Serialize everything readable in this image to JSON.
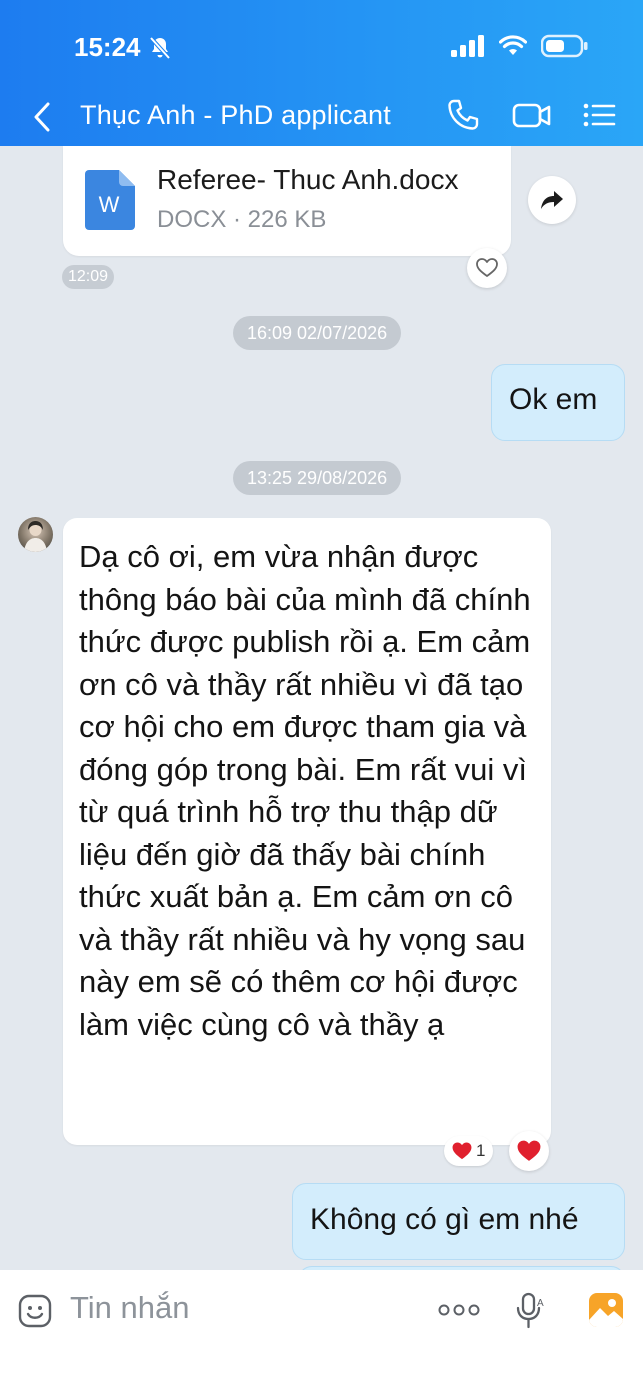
{
  "status_bar": {
    "time": "15:24"
  },
  "header": {
    "title": "Thục Anh - PhD applicant"
  },
  "messages": {
    "file": {
      "name": "Referee- Thuc Anh.docx",
      "meta": "DOCX · 226 KB",
      "icon_letter": "W",
      "time": "12:09"
    },
    "date_1": "16:09 02/07/2026",
    "out_1": "Ok em",
    "date_2": "13:25 29/08/2026",
    "in_1": "Dạ cô ơi, em vừa nhận được thông báo bài của mình đã chính thức được publish rồi ạ. Em cảm ơn cô và thầy rất nhiều vì đã tạo cơ hội cho em được tham gia và đóng góp trong bài. Em rất vui vì từ quá trình hỗ trợ thu thập dữ liệu đến giờ đã thấy bài chính thức xuất bản ạ. Em cảm ơn cô và thầy rất nhiều và hy vọng sau này em sẽ có thêm cơ hội được làm việc cùng cô và thầy ạ",
    "in_1_reaction_count": "1",
    "out_2": "Không có gì em nhé"
  },
  "input": {
    "placeholder": "Tin nhắn"
  },
  "colors": {
    "header_start": "#1d7cf0",
    "header_end": "#2aa6f7",
    "bubble_out": "#d3edfc",
    "heart": "#e0202e"
  }
}
